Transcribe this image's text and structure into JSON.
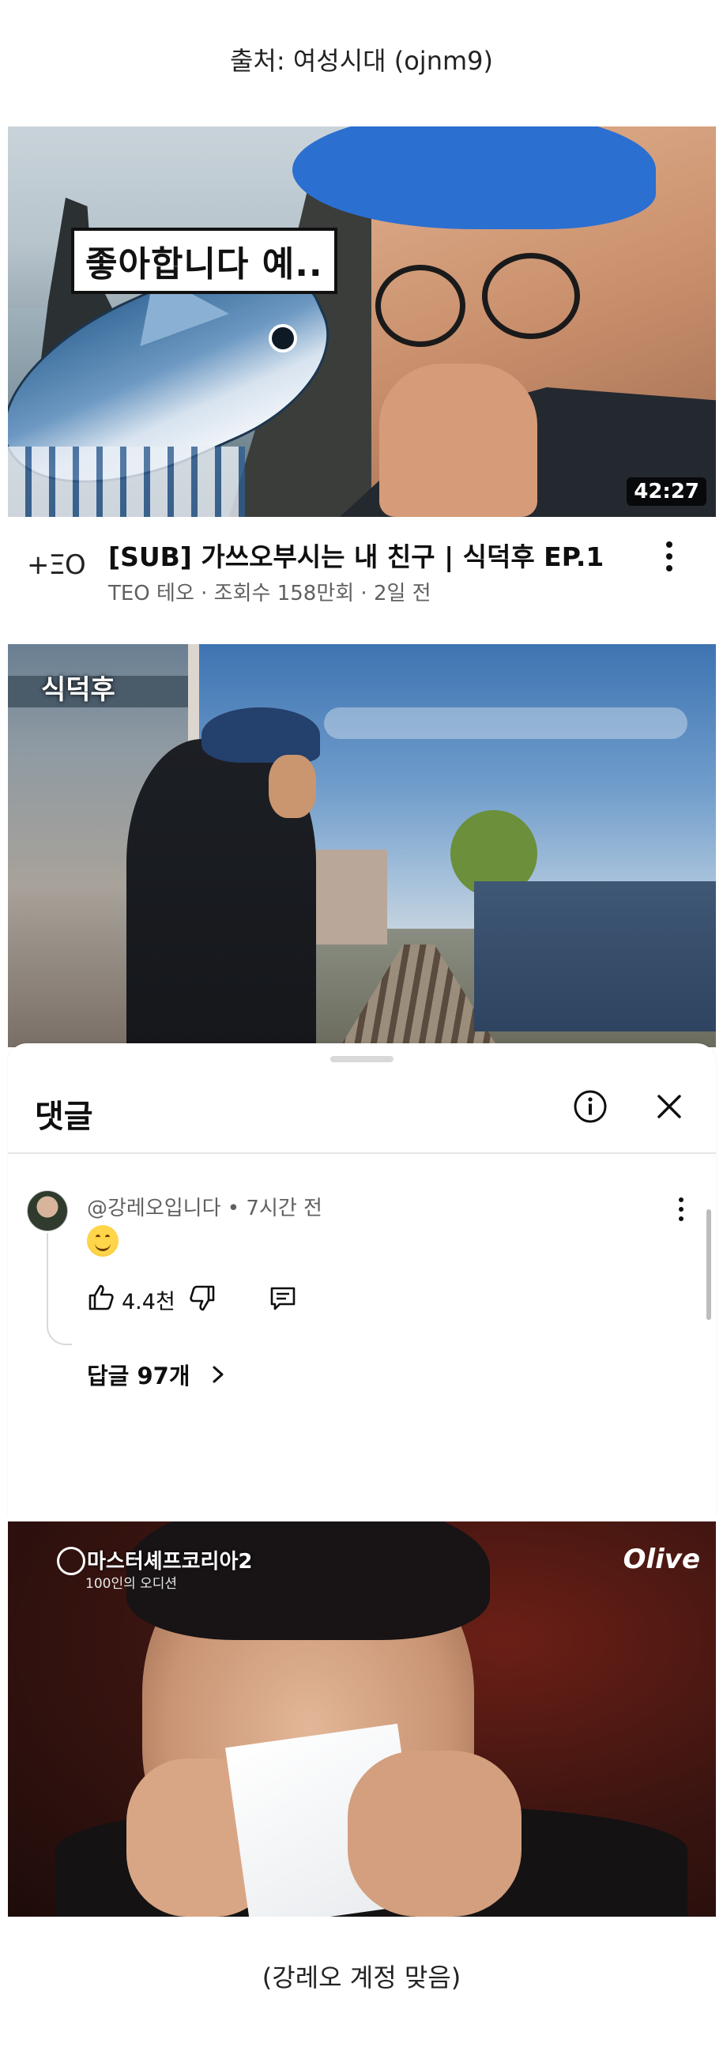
{
  "source_caption": "출처: 여성시대 (ojnm9)",
  "video": {
    "thumbnail_caption": "좋아합니다 예..",
    "duration": "42:27",
    "channel_logo_text": "+ΞO",
    "title": "[SUB] 가쓰오부시는 내 친구 | 식덕후 EP.1",
    "meta": "TEO 테오 · 조회수 158만회 · 2일 전",
    "kebab_icon": "more-vert-icon"
  },
  "second_thumbnail": {
    "show_logo": "식덕후"
  },
  "comments_panel": {
    "title": "댓글",
    "info_icon": "info-icon",
    "close_icon": "close-icon",
    "comment": {
      "author": "@강레오입니다",
      "time": "• 7시간 전",
      "emoji": "smiling-face-emoji",
      "like_count": "4.4천",
      "replies_label": "답글 97개"
    }
  },
  "third_thumbnail": {
    "show_logo": "마스터셰프코리아2",
    "show_sub": "100인의 오디션",
    "channel": "Olive"
  },
  "footer_note": "(강레오 계정 맞음)"
}
